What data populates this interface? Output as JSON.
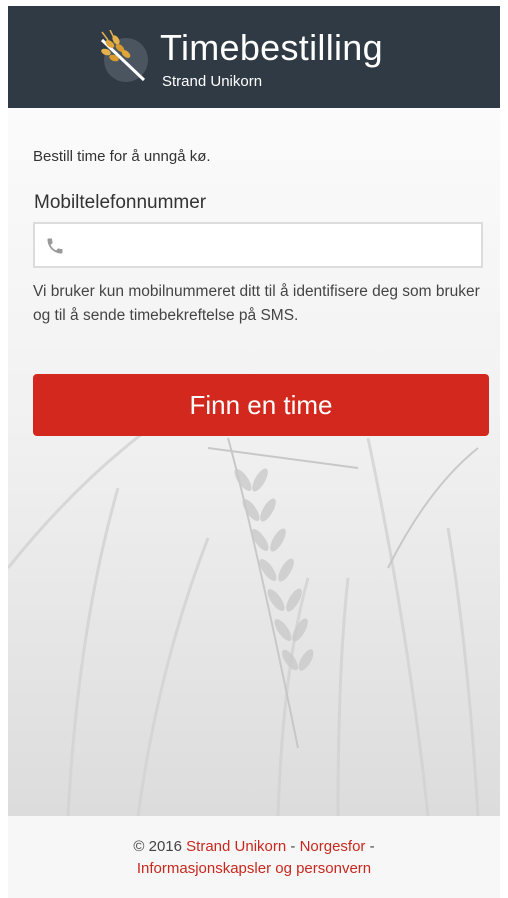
{
  "header": {
    "title": "Timebestilling",
    "subtitle": "Strand Unikorn",
    "background_color": "#2f3a44",
    "logo_icon": "wheat-logo-icon"
  },
  "form": {
    "intro": "Bestill time for å unngå kø.",
    "phone_label": "Mobiltelefonnummer",
    "phone_value": "",
    "phone_placeholder": "",
    "phone_icon": "phone-icon",
    "help_text": "Vi bruker kun mobilnummeret ditt til å identifisere deg som bruker og til å sende timebekreftelse på SMS.",
    "submit_label": "Finn en time",
    "accent_color": "#d2281d"
  },
  "footer": {
    "copyright": "© 2016 ",
    "link_company": "Strand Unikorn",
    "sep1": " - ",
    "link_norgesfor": "Norgesfor",
    "sep2": " -",
    "link_privacy": "Informasjonskapsler og personvern",
    "link_color": "#c8281e"
  }
}
